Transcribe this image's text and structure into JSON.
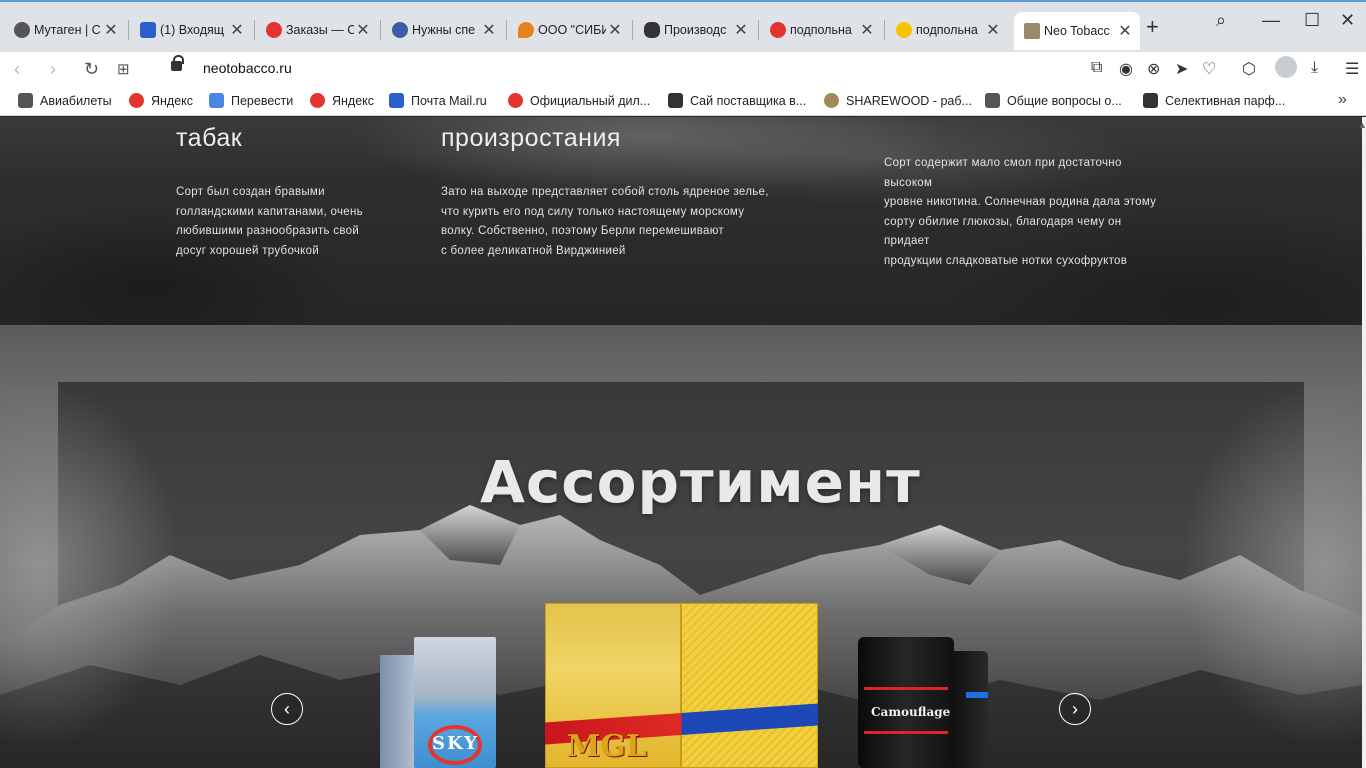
{
  "browser": {
    "tabs": [
      {
        "title": "Мутаген | С",
        "color": "#555555"
      },
      {
        "title": "(1) Входящ",
        "color": "#2a5fcc"
      },
      {
        "title": "Заказы — С",
        "color": "#e3342f"
      },
      {
        "title": "Нужны спе",
        "color": "#3b5aa8"
      },
      {
        "title": "ООО \"СИБИ",
        "color": "#e8821a"
      },
      {
        "title": "Производс",
        "color": "#333333"
      },
      {
        "title": "подпольна",
        "color": "#e3342f"
      },
      {
        "title": "подпольна",
        "color": "#f5c400"
      },
      {
        "title": "Neo Tobacc",
        "color": "#9a8a6a"
      }
    ],
    "new_tab_icon": "plus-icon",
    "url": "neotobacco.ru",
    "bookmarks": [
      {
        "label": "Авиабилеты",
        "color": "#555555"
      },
      {
        "label": "Яндекс",
        "color": "#e3342f"
      },
      {
        "label": "Перевести",
        "color": "#4a86e8"
      },
      {
        "label": "Яндекс",
        "color": "#e3342f"
      },
      {
        "label": "Почта Mail.ru",
        "color": "#2a5fcc"
      },
      {
        "label": "Официальный дил...",
        "color": "#e3342f"
      },
      {
        "label": "Сай поставщика в...",
        "color": "#333333"
      },
      {
        "label": "SHAREWOOD - раб...",
        "color": "#a08a5a"
      },
      {
        "label": "Общие вопросы о...",
        "color": "#555555"
      },
      {
        "label": "Селективная парф...",
        "color": "#333333"
      }
    ]
  },
  "columns": [
    {
      "title": "табак",
      "text": [
        "Сорт был создан бравыми",
        "голландскими капитанами, очень",
        "любившими разнообразить свой",
        "досуг хорошей трубочкой"
      ]
    },
    {
      "title": "произростания",
      "text": [
        "Зато на выходе представляет собой столь ядреное зелье,",
        "что курить его под силу только настоящему морскому",
        "волку. Собственно, поэтому Берли перемешивают",
        "с более деликатной Вирджинией"
      ]
    },
    {
      "title": "",
      "text": [
        "Сорт содержит мало смол при достаточно",
        "высоком",
        "уровне никотина. Солнечная родина дала этому",
        "сорту обилие глюкозы, благодаря чему он",
        "придает",
        "продукции сладковатые нотки сухофруктов"
      ]
    }
  ],
  "assortment": {
    "title": "Ассортимент",
    "prev_icon": "chevron-left-icon",
    "next_icon": "chevron-right-icon",
    "products": [
      {
        "brand": "SKY",
        "color": "#4aa3df"
      },
      {
        "brand": "MGL",
        "color": "#e8b820"
      },
      {
        "brand": "Camouflage",
        "color": "#111111"
      }
    ]
  }
}
